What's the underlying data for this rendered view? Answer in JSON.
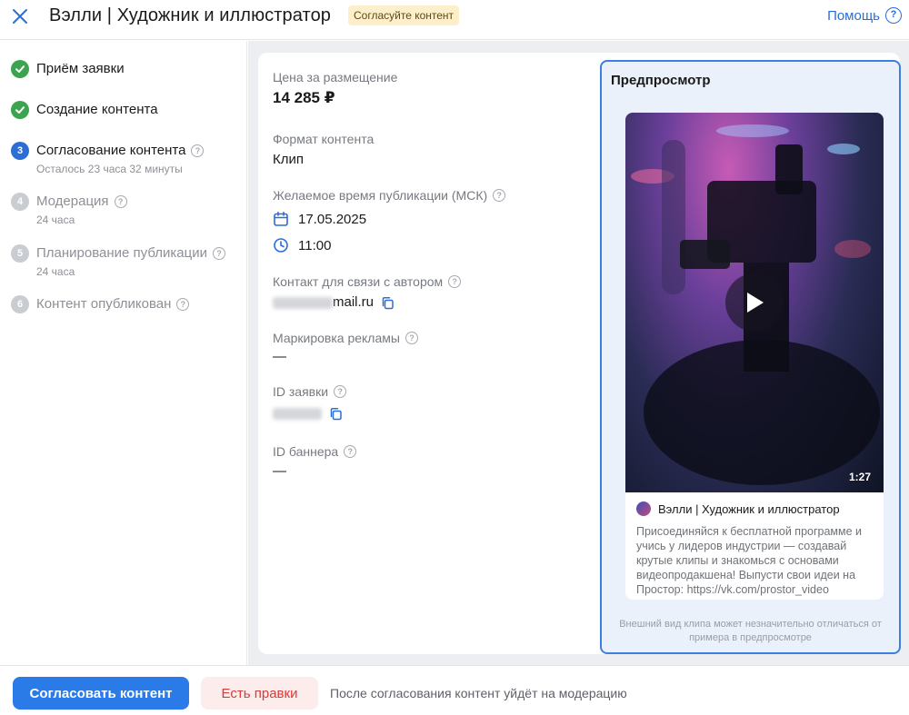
{
  "header": {
    "title": "Вэлли | Художник и иллюстратор",
    "status_badge": "Согласуйте контент",
    "help_label": "Помощь",
    "help_icon_glyph": "?"
  },
  "steps": [
    {
      "num": "1",
      "title": "Приём заявки",
      "sub": "",
      "state": "done",
      "help": false
    },
    {
      "num": "2",
      "title": "Создание контента",
      "sub": "",
      "state": "done",
      "help": false
    },
    {
      "num": "3",
      "title": "Согласование контента",
      "sub": "Осталось 23 часа 32 минуты",
      "state": "active",
      "help": true
    },
    {
      "num": "4",
      "title": "Модерация",
      "sub": "24 часа",
      "state": "pending",
      "help": true
    },
    {
      "num": "5",
      "title": "Планирование публикации",
      "sub": "24 часа",
      "state": "pending",
      "help": true
    },
    {
      "num": "6",
      "title": "Контент опубликован",
      "sub": "",
      "state": "pending",
      "help": true
    }
  ],
  "details": {
    "price": {
      "label": "Цена за размещение",
      "value": "14 285 ₽"
    },
    "format": {
      "label": "Формат контента",
      "value": "Клип"
    },
    "publish_time": {
      "label": "Желаемое время публикации (МСК)",
      "date": "17.05.2025",
      "time": "11:00"
    },
    "contact": {
      "label": "Контакт для связи с автором",
      "value_visible": "mail.ru"
    },
    "ad_marking": {
      "label": "Маркировка рекламы",
      "value": "—"
    },
    "request_id": {
      "label": "ID заявки"
    },
    "banner_id": {
      "label": "ID баннера",
      "value": "—"
    }
  },
  "preview": {
    "title": "Предпросмотр",
    "duration": "1:27",
    "author": "Вэлли | Художник и иллюстратор",
    "description": "Присоединяйся к бесплатной программе и учись у лидеров индустрии — создавай крутые клипы и знакомься с основами видеопродакшена! Выпусти свои идеи на Простор: https://vk.com/prostor_video",
    "note": "Внешний вид клипа может незначительно отличаться от примера в предпросмотре"
  },
  "footer": {
    "approve_label": "Согласовать контент",
    "edits_label": "Есть правки",
    "note": "После согласования контент уйдёт на модерацию"
  },
  "colors": {
    "accent": "#2a7be8",
    "done": "#3ca351",
    "badge_bg": "#fcefc9",
    "danger_text": "#d63b3b"
  }
}
